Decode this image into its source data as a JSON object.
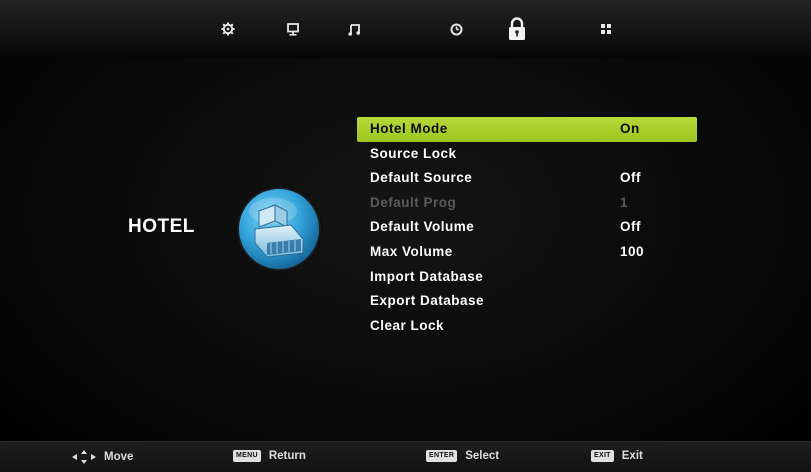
{
  "topbar": {
    "tabs": [
      {
        "icon": "picture-settings-icon"
      },
      {
        "icon": "screen-icon"
      },
      {
        "icon": "music-note-icon"
      },
      {
        "icon": "clock-icon"
      },
      {
        "icon": "lock-icon",
        "active": true
      },
      {
        "icon": "grid-icon"
      }
    ]
  },
  "section": {
    "title": "HOTEL",
    "badge_icon": "hotel-badge-icon"
  },
  "menu": {
    "items": [
      {
        "label": "Hotel Mode",
        "value": "On",
        "state": "selected"
      },
      {
        "label": "Source Lock",
        "value": "",
        "state": "normal"
      },
      {
        "label": "Default Source",
        "value": "Off",
        "state": "normal"
      },
      {
        "label": "Default Prog",
        "value": "1",
        "state": "disabled"
      },
      {
        "label": "Default Volume",
        "value": "Off",
        "state": "normal"
      },
      {
        "label": "Max Volume",
        "value": "100",
        "state": "normal"
      },
      {
        "label": "Import Database",
        "value": "",
        "state": "normal"
      },
      {
        "label": "Export Database",
        "value": "",
        "state": "normal"
      },
      {
        "label": "Clear Lock",
        "value": "",
        "state": "normal"
      }
    ]
  },
  "footer": {
    "move": {
      "label": "Move",
      "icon": "navigation-arrows-icon"
    },
    "return": {
      "key": "MENU",
      "label": "Return"
    },
    "select": {
      "key": "ENTER",
      "label": "Select"
    },
    "exit": {
      "key": "EXIT",
      "label": "Exit"
    }
  },
  "colors": {
    "highlight": "#a8cf2a",
    "disabled_text": "#5a5a5a",
    "badge_blue": "#35a8dc"
  }
}
